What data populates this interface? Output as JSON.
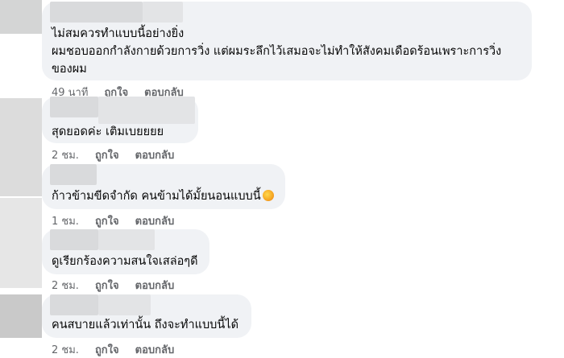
{
  "comments": [
    {
      "lines": [
        "ไม่สมควรทำแบบนี้อย่างยิ่ง",
        "ผมชอบออกกำลังกายด้วยการวิ่ง แต่ผมระลึกไว้เสมอจะไม่ทำให้สังคมเดือดร้อนเพราะการวิ่ง",
        "ของผม"
      ],
      "time": "49 นาที",
      "like": "ถูกใจ",
      "reply": "ตอบกลับ"
    },
    {
      "lines": [
        "สุดยอดค่ะ เติมเบยยยย"
      ],
      "time": "2 ชม.",
      "like": "ถูกใจ",
      "reply": "ตอบกลับ"
    },
    {
      "lines": [
        "ก้าวข้ามขีดจำกัด คนข้ามได้มั้ยนอนแบบนี้"
      ],
      "time": "1 ชม.",
      "like": "ถูกใจ",
      "reply": "ตอบกลับ",
      "emoji": "laughing-crying-emoji"
    },
    {
      "lines": [
        "ดูเรียกร้องความสนใจเสล่อๆดี"
      ],
      "time": "2 ชม.",
      "like": "ถูกใจ",
      "reply": "ตอบกลับ"
    },
    {
      "lines": [
        "คนสบายแล้วเท่านั้น ถึงจะทำแบบนี้ได้"
      ],
      "time": "2 ชม.",
      "like": "ถูกใจ",
      "reply": "ตอบกลับ"
    }
  ],
  "colors": {
    "bubble": "#f0f2f5",
    "meta": "#65676b",
    "avatar_placeholder": "#d7d7d7"
  }
}
